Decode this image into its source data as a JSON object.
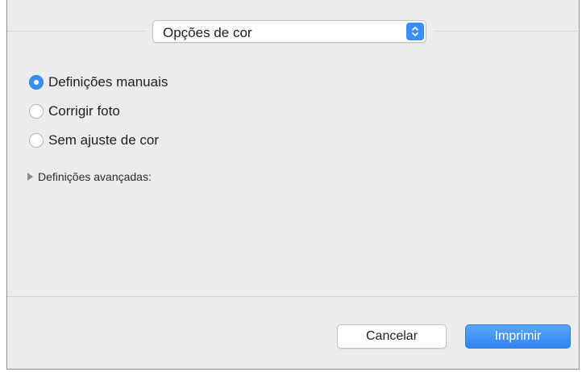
{
  "popup": {
    "selected": "Opções de cor"
  },
  "color_mode": {
    "options": [
      {
        "label": "Definições manuais",
        "selected": true
      },
      {
        "label": "Corrigir foto",
        "selected": false
      },
      {
        "label": "Sem ajuste de cor",
        "selected": false
      }
    ]
  },
  "advanced": {
    "label": "Definições avançadas:",
    "expanded": false
  },
  "buttons": {
    "cancel": "Cancelar",
    "print": "Imprimir"
  },
  "colors": {
    "accent": "#3a8ff6",
    "panel_bg": "#ececec"
  },
  "icons": {
    "popup_arrows": "up-down-chevron-icon",
    "disclosure": "disclosure-triangle-icon"
  }
}
